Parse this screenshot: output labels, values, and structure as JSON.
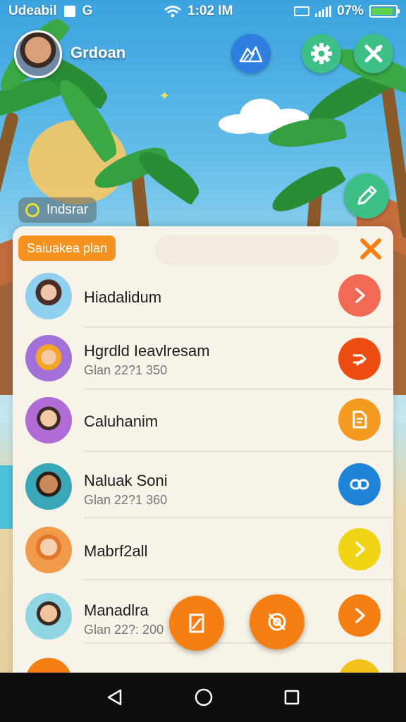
{
  "status_bar": {
    "carrier": "Udeabil",
    "notif_glyph": "G",
    "time": "1:02 IM",
    "battery_text": "07%",
    "battery_level": 0.9
  },
  "header": {
    "username": "Grdoan",
    "indicator_label": "Indsrar"
  },
  "panel": {
    "plan_label": "Saiuakea plan",
    "search_value": "",
    "contacts": [
      {
        "name": "Hiadalidum",
        "sub": "",
        "button_color": "#f26a55",
        "button_icon": "chevron-right-icon"
      },
      {
        "name": "Hgrdld Ieavlresam",
        "sub": "Glan 22?1 350",
        "button_color": "#ee4d12",
        "button_icon": "share-icon"
      },
      {
        "name": "Caluhanim",
        "sub": "",
        "button_color": "#f59a20",
        "button_icon": "document-icon"
      },
      {
        "name": "Naluak Soni",
        "sub": "Glan 22?1 360",
        "button_color": "#1f83d8",
        "button_icon": "link-icon"
      },
      {
        "name": "Mabrf2all",
        "sub": "",
        "button_color": "#f2d416",
        "button_icon": "chevron-right-icon"
      },
      {
        "name": "Manadlra",
        "sub": "Glan 22?: 200",
        "button_color": "#f57f12",
        "button_icon": "chevron-right-icon"
      }
    ]
  },
  "colors": {
    "accent_orange": "#f57f12",
    "accent_green": "#3fbf88",
    "accent_blue": "#2f7fe0",
    "panel_bg": "#f7f3e8"
  }
}
